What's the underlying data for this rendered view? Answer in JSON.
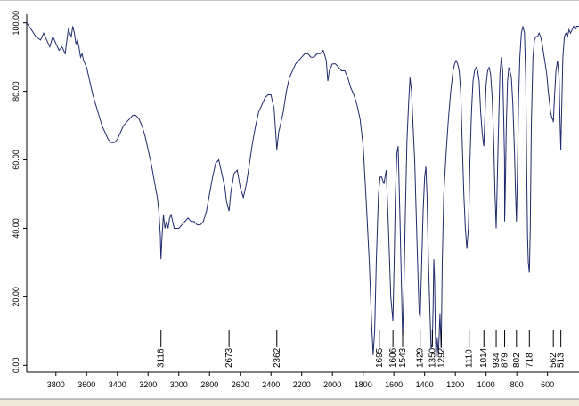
{
  "chart_data": {
    "type": "line",
    "title": "",
    "xlabel": "",
    "ylabel": "",
    "xlim": [
      3990,
      395
    ],
    "ylim": [
      -2,
      102
    ],
    "x_ticks": [
      3800,
      3600,
      3400,
      3200,
      3000,
      2800,
      2600,
      2400,
      2200,
      2000,
      1800,
      1600,
      1400,
      1200,
      1000,
      800,
      600
    ],
    "y_ticks": [
      "100.00",
      "80.00",
      "60.00",
      "40.00",
      "20.00",
      "0.00"
    ],
    "y_tick_values": [
      100,
      80,
      60,
      40,
      20,
      0
    ],
    "grid": false,
    "series": [
      {
        "values": [
          [
            3990,
            100
          ],
          [
            3960,
            98
          ],
          [
            3930,
            96
          ],
          [
            3900,
            95
          ],
          [
            3880,
            97
          ],
          [
            3860,
            95
          ],
          [
            3840,
            93
          ],
          [
            3820,
            96
          ],
          [
            3800,
            94
          ],
          [
            3780,
            92
          ],
          [
            3760,
            93
          ],
          [
            3740,
            91
          ],
          [
            3720,
            98
          ],
          [
            3700,
            96
          ],
          [
            3690,
            99
          ],
          [
            3680,
            97
          ],
          [
            3670,
            94
          ],
          [
            3660,
            95
          ],
          [
            3650,
            93
          ],
          [
            3640,
            90
          ],
          [
            3630,
            91
          ],
          [
            3620,
            89
          ],
          [
            3600,
            87
          ],
          [
            3580,
            83
          ],
          [
            3560,
            79
          ],
          [
            3540,
            76
          ],
          [
            3520,
            73
          ],
          [
            3500,
            70
          ],
          [
            3480,
            68
          ],
          [
            3460,
            66
          ],
          [
            3440,
            65
          ],
          [
            3420,
            65
          ],
          [
            3400,
            66
          ],
          [
            3380,
            68
          ],
          [
            3360,
            70
          ],
          [
            3340,
            71
          ],
          [
            3320,
            72
          ],
          [
            3300,
            73
          ],
          [
            3280,
            73
          ],
          [
            3260,
            72
          ],
          [
            3240,
            70
          ],
          [
            3220,
            67
          ],
          [
            3200,
            63
          ],
          [
            3180,
            59
          ],
          [
            3160,
            54
          ],
          [
            3140,
            49
          ],
          [
            3130,
            45
          ],
          [
            3120,
            38
          ],
          [
            3116,
            31
          ],
          [
            3110,
            37
          ],
          [
            3100,
            44
          ],
          [
            3090,
            40
          ],
          [
            3080,
            42
          ],
          [
            3070,
            40
          ],
          [
            3060,
            43
          ],
          [
            3050,
            44
          ],
          [
            3040,
            42
          ],
          [
            3030,
            40
          ],
          [
            3000,
            40
          ],
          [
            2980,
            41
          ],
          [
            2960,
            42
          ],
          [
            2940,
            43
          ],
          [
            2920,
            42
          ],
          [
            2900,
            42
          ],
          [
            2880,
            41
          ],
          [
            2860,
            41
          ],
          [
            2840,
            42
          ],
          [
            2820,
            45
          ],
          [
            2800,
            50
          ],
          [
            2780,
            55
          ],
          [
            2760,
            59
          ],
          [
            2740,
            60
          ],
          [
            2720,
            56
          ],
          [
            2700,
            52
          ],
          [
            2690,
            48
          ],
          [
            2673,
            45
          ],
          [
            2660,
            51
          ],
          [
            2640,
            56
          ],
          [
            2620,
            57
          ],
          [
            2600,
            52
          ],
          [
            2580,
            49
          ],
          [
            2560,
            53
          ],
          [
            2540,
            59
          ],
          [
            2520,
            65
          ],
          [
            2500,
            70
          ],
          [
            2480,
            74
          ],
          [
            2460,
            76
          ],
          [
            2440,
            78
          ],
          [
            2420,
            79
          ],
          [
            2400,
            79
          ],
          [
            2380,
            75
          ],
          [
            2362,
            63
          ],
          [
            2350,
            68
          ],
          [
            2340,
            70
          ],
          [
            2320,
            74
          ],
          [
            2300,
            80
          ],
          [
            2280,
            84
          ],
          [
            2260,
            86
          ],
          [
            2240,
            88
          ],
          [
            2220,
            89
          ],
          [
            2200,
            90
          ],
          [
            2180,
            91
          ],
          [
            2160,
            91
          ],
          [
            2140,
            90
          ],
          [
            2120,
            90
          ],
          [
            2100,
            91
          ],
          [
            2080,
            91
          ],
          [
            2060,
            92
          ],
          [
            2040,
            89
          ],
          [
            2030,
            83
          ],
          [
            2020,
            86
          ],
          [
            2000,
            88
          ],
          [
            1980,
            88
          ],
          [
            1960,
            87
          ],
          [
            1940,
            86
          ],
          [
            1920,
            86
          ],
          [
            1900,
            84
          ],
          [
            1880,
            81
          ],
          [
            1860,
            79
          ],
          [
            1840,
            76
          ],
          [
            1820,
            72
          ],
          [
            1800,
            64
          ],
          [
            1780,
            48
          ],
          [
            1760,
            30
          ],
          [
            1745,
            12
          ],
          [
            1735,
            3
          ],
          [
            1725,
            10
          ],
          [
            1715,
            30
          ],
          [
            1700,
            50
          ],
          [
            1690,
            55
          ],
          [
            1680,
            55
          ],
          [
            1665,
            53
          ],
          [
            1650,
            57
          ],
          [
            1635,
            40
          ],
          [
            1620,
            20
          ],
          [
            1606,
            13
          ],
          [
            1598,
            30
          ],
          [
            1590,
            50
          ],
          [
            1580,
            62
          ],
          [
            1572,
            64
          ],
          [
            1560,
            42
          ],
          [
            1550,
            22
          ],
          [
            1543,
            8
          ],
          [
            1535,
            22
          ],
          [
            1525,
            45
          ],
          [
            1515,
            65
          ],
          [
            1505,
            76
          ],
          [
            1495,
            84
          ],
          [
            1485,
            80
          ],
          [
            1475,
            70
          ],
          [
            1465,
            60
          ],
          [
            1452,
            40
          ],
          [
            1442,
            25
          ],
          [
            1435,
            15
          ],
          [
            1429,
            14
          ],
          [
            1420,
            28
          ],
          [
            1410,
            45
          ],
          [
            1400,
            55
          ],
          [
            1392,
            58
          ],
          [
            1385,
            50
          ],
          [
            1375,
            30
          ],
          [
            1365,
            15
          ],
          [
            1358,
            5
          ],
          [
            1350,
            6
          ],
          [
            1345,
            17
          ],
          [
            1340,
            31
          ],
          [
            1335,
            25
          ],
          [
            1330,
            10
          ],
          [
            1325,
            2
          ],
          [
            1318,
            8
          ],
          [
            1310,
            3
          ],
          [
            1300,
            15
          ],
          [
            1292,
            5
          ],
          [
            1285,
            30
          ],
          [
            1275,
            50
          ],
          [
            1260,
            62
          ],
          [
            1245,
            72
          ],
          [
            1230,
            80
          ],
          [
            1215,
            86
          ],
          [
            1205,
            88
          ],
          [
            1195,
            89
          ],
          [
            1185,
            88
          ],
          [
            1175,
            86
          ],
          [
            1165,
            80
          ],
          [
            1155,
            65
          ],
          [
            1145,
            50
          ],
          [
            1135,
            40
          ],
          [
            1125,
            34
          ],
          [
            1115,
            40
          ],
          [
            1110,
            48
          ],
          [
            1105,
            60
          ],
          [
            1095,
            74
          ],
          [
            1085,
            83
          ],
          [
            1075,
            86
          ],
          [
            1065,
            87
          ],
          [
            1055,
            86
          ],
          [
            1045,
            83
          ],
          [
            1035,
            74
          ],
          [
            1025,
            68
          ],
          [
            1018,
            65
          ],
          [
            1014,
            64
          ],
          [
            1008,
            72
          ],
          [
            1000,
            82
          ],
          [
            990,
            86
          ],
          [
            980,
            87
          ],
          [
            970,
            85
          ],
          [
            960,
            78
          ],
          [
            950,
            65
          ],
          [
            942,
            50
          ],
          [
            938,
            45
          ],
          [
            934,
            40
          ],
          [
            928,
            52
          ],
          [
            920,
            68
          ],
          [
            910,
            85
          ],
          [
            900,
            90
          ],
          [
            892,
            86
          ],
          [
            885,
            72
          ],
          [
            880,
            60
          ],
          [
            879,
            42
          ],
          [
            875,
            50
          ],
          [
            868,
            70
          ],
          [
            860,
            83
          ],
          [
            852,
            87
          ],
          [
            845,
            86
          ],
          [
            835,
            84
          ],
          [
            825,
            76
          ],
          [
            815,
            62
          ],
          [
            808,
            50
          ],
          [
            802,
            42
          ],
          [
            796,
            55
          ],
          [
            788,
            78
          ],
          [
            780,
            90
          ],
          [
            770,
            97
          ],
          [
            760,
            99
          ],
          [
            750,
            97
          ],
          [
            742,
            84
          ],
          [
            735,
            55
          ],
          [
            730,
            38
          ],
          [
            725,
            30
          ],
          [
            718,
            27
          ],
          [
            712,
            40
          ],
          [
            705,
            70
          ],
          [
            695,
            90
          ],
          [
            685,
            95
          ],
          [
            675,
            96
          ],
          [
            665,
            96
          ],
          [
            655,
            97
          ],
          [
            645,
            96
          ],
          [
            635,
            94
          ],
          [
            625,
            91
          ],
          [
            615,
            88
          ],
          [
            605,
            85
          ],
          [
            595,
            80
          ],
          [
            580,
            74
          ],
          [
            570,
            72
          ],
          [
            566,
            72
          ],
          [
            562,
            71
          ],
          [
            555,
            78
          ],
          [
            545,
            86
          ],
          [
            535,
            89
          ],
          [
            525,
            84
          ],
          [
            518,
            70
          ],
          [
            513,
            63
          ],
          [
            508,
            74
          ],
          [
            500,
            90
          ],
          [
            490,
            96
          ],
          [
            480,
            97
          ],
          [
            470,
            96
          ],
          [
            460,
            98
          ],
          [
            450,
            97
          ],
          [
            440,
            98
          ],
          [
            430,
            99
          ],
          [
            420,
            98
          ],
          [
            410,
            99
          ],
          [
            395,
            99
          ]
        ]
      }
    ],
    "peak_labels": [
      "3116",
      "2673",
      "2362",
      "1695",
      "1606",
      "1543",
      "1429",
      "1350",
      "1292",
      "1110",
      "1014",
      "934",
      "879",
      "802",
      "718",
      "562",
      "513"
    ],
    "peak_positions": [
      3116,
      2673,
      2362,
      1695,
      1606,
      1543,
      1429,
      1350,
      1292,
      1110,
      1014,
      934,
      879,
      802,
      718,
      562,
      513
    ],
    "colors": {
      "line": "#1f2a6b",
      "background": "#ffffff",
      "ui_strip": "#ece9d8"
    }
  }
}
